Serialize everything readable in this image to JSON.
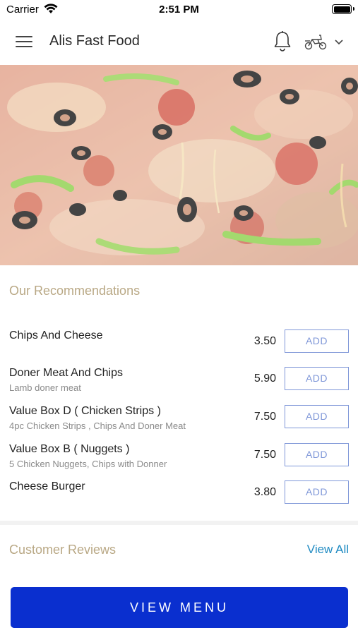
{
  "status_bar": {
    "carrier": "Carrier",
    "time": "2:51 PM"
  },
  "header": {
    "title": "Alis Fast Food",
    "icons": [
      "menu-icon",
      "bell-icon",
      "scooter-icon",
      "chevron-down-icon"
    ]
  },
  "hero": {
    "image": "pizza-photo"
  },
  "recommendations": {
    "title": "Our Recommendations",
    "add_label": "ADD",
    "items": [
      {
        "name": "Chips And Cheese",
        "description": "",
        "price": "3.50"
      },
      {
        "name": "Doner Meat And Chips",
        "description": "Lamb doner meat",
        "price": "5.90"
      },
      {
        "name": "Value Box D ( Chicken Strips )",
        "description": "4pc Chicken Strips , Chips And Doner Meat",
        "price": "7.50"
      },
      {
        "name": "Value Box B ( Nuggets )",
        "description": "5 Chicken Nuggets, Chips with Donner",
        "price": "7.50"
      },
      {
        "name": "Cheese Burger",
        "description": "",
        "price": "3.80"
      }
    ]
  },
  "reviews": {
    "title": "Customer Reviews",
    "view_all": "View All"
  },
  "cta": {
    "label": "VIEW MENU"
  },
  "colors": {
    "accent": "#0a2fcf",
    "section_title": "#b9a885",
    "add_button": "#7f97d8",
    "link": "#1e8ac2"
  }
}
